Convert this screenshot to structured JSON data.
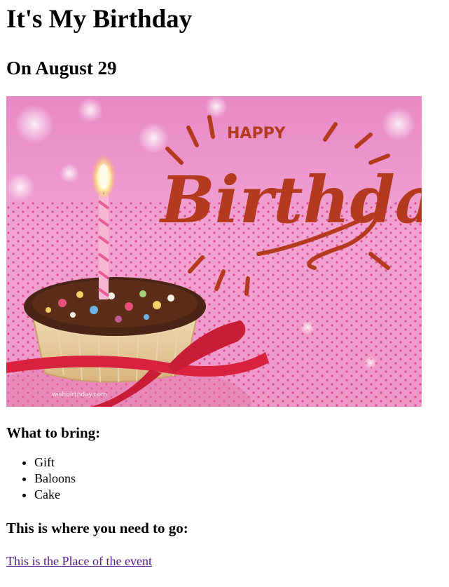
{
  "title": "It's My Birthday",
  "subtitle": "On August 29",
  "image": {
    "lettering_happy": "HAPPY",
    "lettering_birthday": "Birthday",
    "watermark": "wishbirthday.com"
  },
  "bring": {
    "heading": "What to bring:",
    "items": [
      "Gift",
      "Baloons",
      "Cake"
    ]
  },
  "go": {
    "heading": "This is where you need to go:",
    "link_text": "This is the Place of the event"
  }
}
